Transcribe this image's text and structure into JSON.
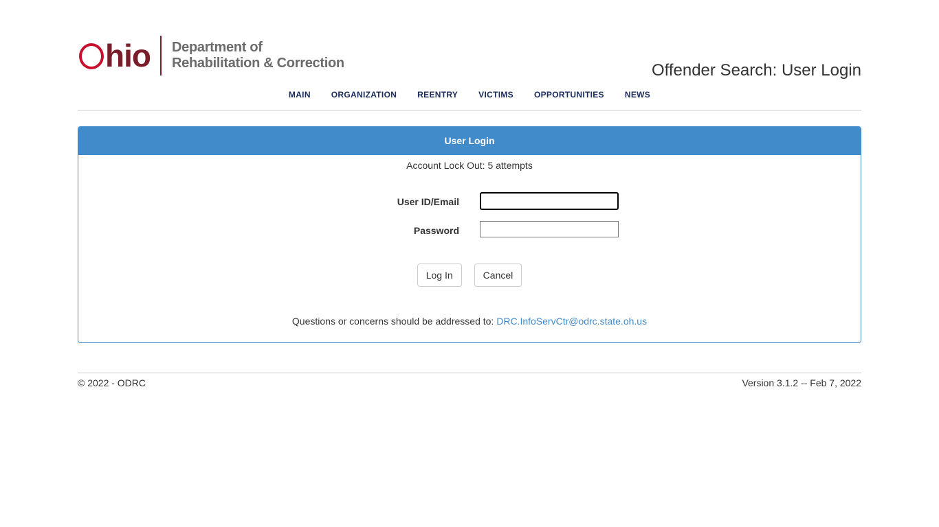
{
  "header": {
    "logo_word": "hio",
    "logo_line1": "Department of",
    "logo_line2": "Rehabilitation & Correction",
    "page_title": "Offender Search: User Login"
  },
  "nav": {
    "items": [
      "MAIN",
      "ORGANIZATION",
      "REENTRY",
      "VICTIMS",
      "OPPORTUNITIES",
      "NEWS"
    ]
  },
  "panel": {
    "heading": "User Login",
    "lockout_text": "Account Lock Out: 5 attempts",
    "user_label": "User ID/Email",
    "user_value": "",
    "password_label": "Password",
    "password_value": "",
    "login_button": "Log In",
    "cancel_button": "Cancel",
    "contact_text": "Questions or concerns should be addressed to:",
    "contact_email": "DRC.InfoServCtr@odrc.state.oh.us"
  },
  "footer": {
    "copyright": "© 2022 - ODRC",
    "version": "Version 3.1.2 -- Feb 7, 2022"
  },
  "colors": {
    "brand_red": "#c8102e",
    "brand_maroon": "#7a1d2b",
    "panel_blue": "#428bca",
    "nav_navy": "#1a2b5c"
  }
}
